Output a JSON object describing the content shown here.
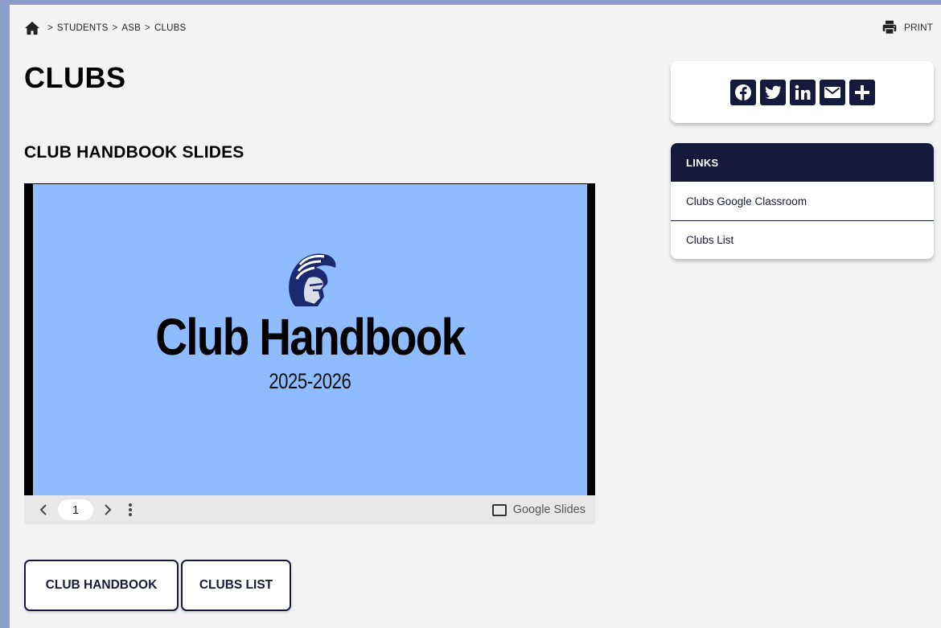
{
  "breadcrumb": {
    "items": [
      "STUDENTS",
      "ASB",
      "CLUBS"
    ],
    "separator": ">"
  },
  "toolbar": {
    "print_label": "PRINT"
  },
  "page_title": "CLUBS",
  "section_title": "CLUB HANDBOOK SLIDES",
  "slides": {
    "title": "Club Handbook",
    "subtitle": "2025-2026",
    "page_number": "1",
    "brand_label": "Google Slides",
    "background_color": "#8fbbff"
  },
  "buttons": {
    "handbook_label": "CLUB HANDBOOK",
    "list_label": "CLUBS LIST"
  },
  "share": {
    "icons": [
      "facebook-icon",
      "twitter-icon",
      "linkedin-icon",
      "email-icon",
      "plus-icon"
    ]
  },
  "links": {
    "header": "LINKS",
    "items": [
      "Clubs Google Classroom",
      "Clubs List"
    ]
  },
  "colors": {
    "navy": "#15193b",
    "frame": "#8c9dc9",
    "page_bg": "#f3f3f3"
  }
}
